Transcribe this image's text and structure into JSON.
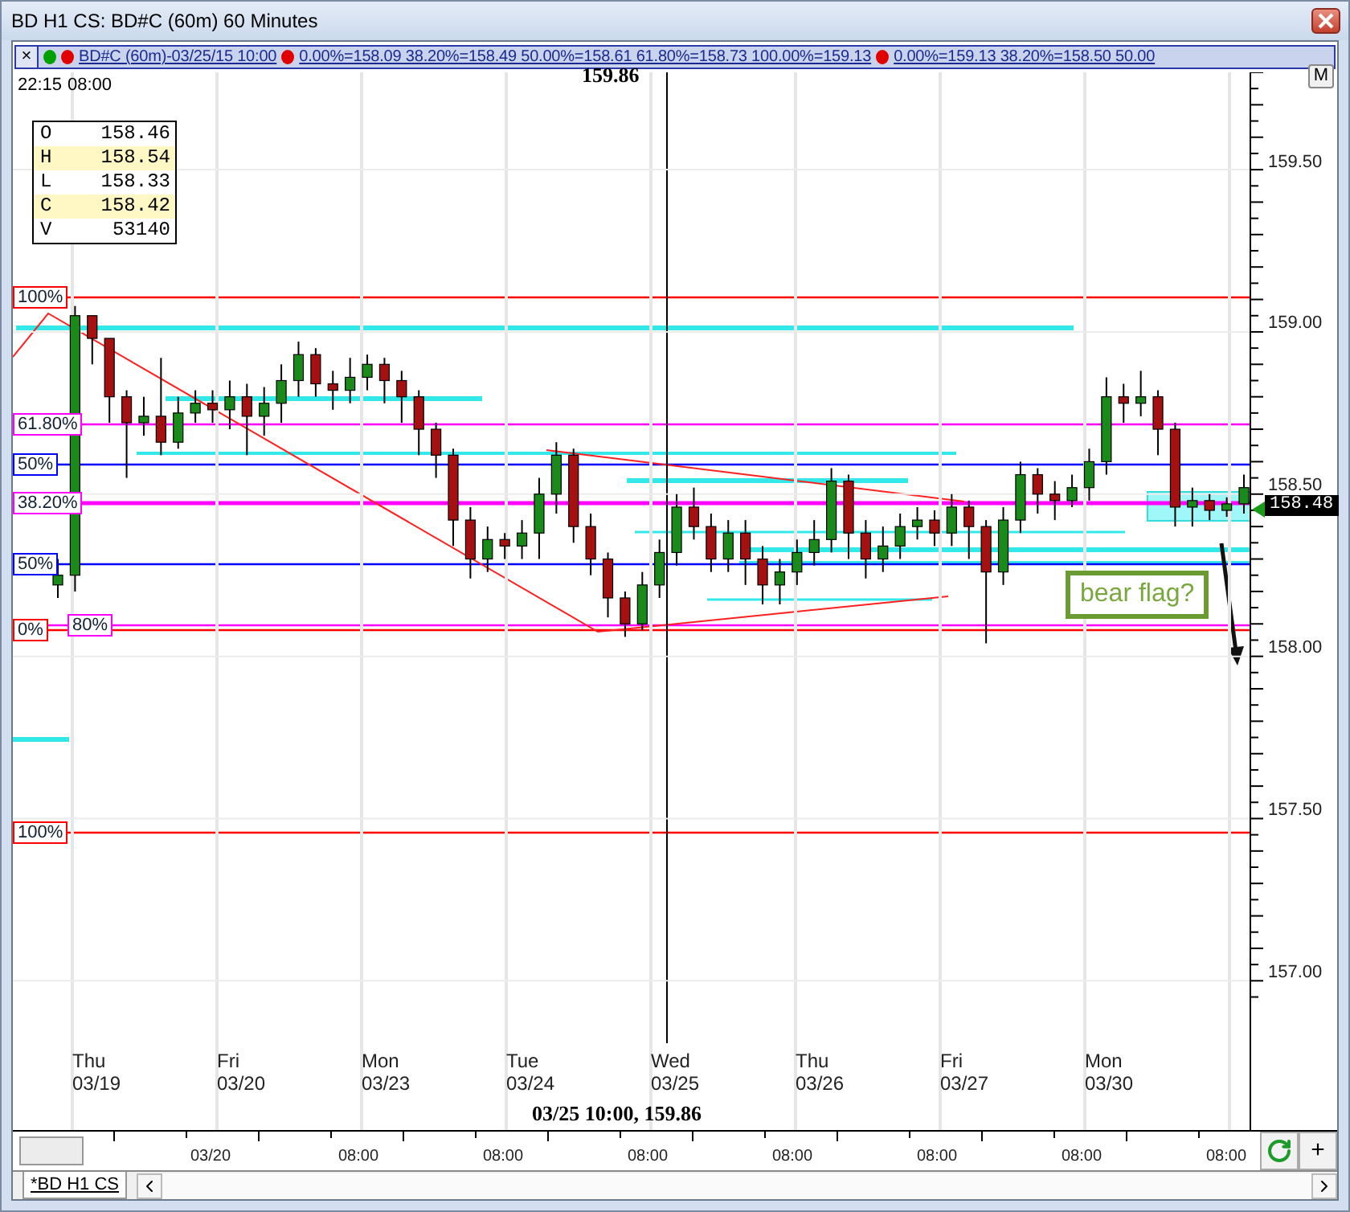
{
  "window": {
    "title": "BD H1 CS: BD#C (60m) 60 Minutes"
  },
  "indicator_bar": {
    "close_label": "×",
    "status_dots": [
      {
        "color": "#00a000"
      },
      {
        "color": "#e00000"
      }
    ],
    "symbol": "BD#C (60m)-03/25/15 10:00",
    "fib_sets": [
      {
        "text": "0.00%=158.09 38.20%=158.49 50.00%=158.61 61.80%=158.73 100.00%=159.13"
      },
      {
        "text": "0.00%=159.13 38.20%=158.50 50.00"
      }
    ]
  },
  "chart": {
    "time_left": "22:15",
    "time_right": "08:00",
    "crosshair_price": "159.86",
    "m_button": "M",
    "ohlc": [
      {
        "label": "O",
        "value": "158.46"
      },
      {
        "label": "H",
        "value": "158.54"
      },
      {
        "label": "L",
        "value": "158.33"
      },
      {
        "label": "C",
        "value": "158.42"
      },
      {
        "label": "V",
        "value": "53140"
      }
    ],
    "fib_labels": [
      {
        "label": "100%",
        "color": "#ff0000"
      },
      {
        "label": "61.80%",
        "color": "#ff00ff"
      },
      {
        "label": "50%",
        "color": "#0000ff"
      },
      {
        "label": "38.20%",
        "color": "#ff00ff"
      },
      {
        "label": "50%",
        "color": "#0000ff"
      },
      {
        "label": "0%",
        "color": "#ff0000"
      },
      {
        "label": "80%",
        "color": "#ff00ff"
      },
      {
        "label": "100%",
        "color": "#ff0000"
      }
    ],
    "chart_data": {
      "type": "candlestick",
      "ohlc": [
        [
          158.22,
          158.3,
          158.18,
          158.25
        ],
        [
          158.25,
          159.08,
          158.2,
          159.05
        ],
        [
          159.05,
          159.05,
          158.9,
          158.98
        ],
        [
          158.98,
          158.98,
          158.72,
          158.8
        ],
        [
          158.8,
          158.82,
          158.55,
          158.72
        ],
        [
          158.72,
          158.8,
          158.68,
          158.74
        ],
        [
          158.74,
          158.92,
          158.62,
          158.66
        ],
        [
          158.66,
          158.8,
          158.64,
          158.75
        ],
        [
          158.75,
          158.82,
          158.72,
          158.78
        ],
        [
          158.78,
          158.82,
          158.72,
          158.76
        ],
        [
          158.76,
          158.85,
          158.7,
          158.8
        ],
        [
          158.8,
          158.84,
          158.62,
          158.74
        ],
        [
          158.74,
          158.83,
          158.68,
          158.78
        ],
        [
          158.78,
          158.9,
          158.72,
          158.85
        ],
        [
          158.85,
          158.97,
          158.8,
          158.93
        ],
        [
          158.93,
          158.95,
          158.8,
          158.84
        ],
        [
          158.84,
          158.88,
          158.76,
          158.82
        ],
        [
          158.82,
          158.92,
          158.78,
          158.86
        ],
        [
          158.86,
          158.93,
          158.82,
          158.9
        ],
        [
          158.9,
          158.92,
          158.78,
          158.85
        ],
        [
          158.85,
          158.88,
          158.72,
          158.8
        ],
        [
          158.8,
          158.82,
          158.62,
          158.7
        ],
        [
          158.7,
          158.72,
          158.55,
          158.62
        ],
        [
          158.62,
          158.64,
          158.34,
          158.42
        ],
        [
          158.42,
          158.46,
          158.24,
          158.3
        ],
        [
          158.3,
          158.4,
          158.26,
          158.36
        ],
        [
          158.36,
          158.38,
          158.3,
          158.34
        ],
        [
          158.34,
          158.42,
          158.3,
          158.38
        ],
        [
          158.38,
          158.55,
          158.3,
          158.5
        ],
        [
          158.5,
          158.66,
          158.44,
          158.62
        ],
        [
          158.62,
          158.64,
          158.35,
          158.4
        ],
        [
          158.4,
          158.44,
          158.25,
          158.3
        ],
        [
          158.3,
          158.32,
          158.12,
          158.18
        ],
        [
          158.18,
          158.2,
          158.06,
          158.1
        ],
        [
          158.1,
          158.26,
          158.08,
          158.22
        ],
        [
          158.22,
          158.36,
          158.18,
          158.32
        ],
        [
          158.32,
          158.5,
          158.28,
          158.46
        ],
        [
          158.46,
          158.52,
          158.36,
          158.4
        ],
        [
          158.4,
          158.44,
          158.26,
          158.3
        ],
        [
          158.3,
          158.42,
          158.26,
          158.38
        ],
        [
          158.38,
          158.42,
          158.22,
          158.3
        ],
        [
          158.3,
          158.34,
          158.16,
          158.22
        ],
        [
          158.22,
          158.3,
          158.16,
          158.26
        ],
        [
          158.26,
          158.36,
          158.22,
          158.32
        ],
        [
          158.32,
          158.42,
          158.28,
          158.36
        ],
        [
          158.36,
          158.58,
          158.32,
          158.54
        ],
        [
          158.54,
          158.56,
          158.3,
          158.38
        ],
        [
          158.38,
          158.42,
          158.24,
          158.3
        ],
        [
          158.3,
          158.4,
          158.26,
          158.34
        ],
        [
          158.34,
          158.44,
          158.3,
          158.4
        ],
        [
          158.4,
          158.46,
          158.36,
          158.42
        ],
        [
          158.42,
          158.45,
          158.34,
          158.38
        ],
        [
          158.38,
          158.5,
          158.34,
          158.46
        ],
        [
          158.46,
          158.48,
          158.3,
          158.4
        ],
        [
          158.4,
          158.42,
          158.04,
          158.26
        ],
        [
          158.26,
          158.46,
          158.22,
          158.42
        ],
        [
          158.42,
          158.6,
          158.38,
          158.56
        ],
        [
          158.56,
          158.58,
          158.44,
          158.5
        ],
        [
          158.5,
          158.54,
          158.42,
          158.48
        ],
        [
          158.48,
          158.56,
          158.46,
          158.52
        ],
        [
          158.52,
          158.64,
          158.48,
          158.6
        ],
        [
          158.6,
          158.86,
          158.56,
          158.8
        ],
        [
          158.8,
          158.84,
          158.72,
          158.78
        ],
        [
          158.78,
          158.88,
          158.74,
          158.8
        ],
        [
          158.8,
          158.82,
          158.62,
          158.7
        ],
        [
          158.7,
          158.72,
          158.4,
          158.46
        ],
        [
          158.46,
          158.52,
          158.4,
          158.48
        ],
        [
          158.48,
          158.5,
          158.42,
          158.45
        ],
        [
          158.45,
          158.49,
          158.43,
          158.47
        ],
        [
          158.47,
          158.56,
          158.44,
          158.52
        ]
      ],
      "ylim": [
        156.54,
        159.8
      ],
      "grid": true,
      "yticks": [
        {
          "value": 159.5,
          "label": "159.50"
        },
        {
          "value": 159,
          "label": "159.00"
        },
        {
          "value": 158.5,
          "label": "158.50"
        },
        {
          "value": 158,
          "label": "158.00"
        },
        {
          "value": 157.5,
          "label": "157.50"
        },
        {
          "value": 157,
          "label": "157.00"
        }
      ]
    },
    "last_price": "158.48",
    "note": "bear flag?",
    "days": [
      {
        "day": "Thu",
        "date": "03/19"
      },
      {
        "day": "Fri",
        "date": "03/20"
      },
      {
        "day": "Mon",
        "date": "03/23"
      },
      {
        "day": "Tue",
        "date": "03/24"
      },
      {
        "day": "Wed",
        "date": "03/25"
      },
      {
        "day": "Thu",
        "date": "03/26"
      },
      {
        "day": "Fri",
        "date": "03/27"
      },
      {
        "day": "Mon",
        "date": "03/30"
      }
    ],
    "crosshair_time": "03/25 10:00, 159.86"
  },
  "time_axis": {
    "ticks": [
      "03/20",
      "08:00",
      "08:00",
      "08:00",
      "08:00",
      "08:00",
      "08:00",
      "08:00"
    ],
    "add_button": "+"
  },
  "tabs": [
    {
      "label": "*BD H1 CS",
      "selected": true
    }
  ]
}
